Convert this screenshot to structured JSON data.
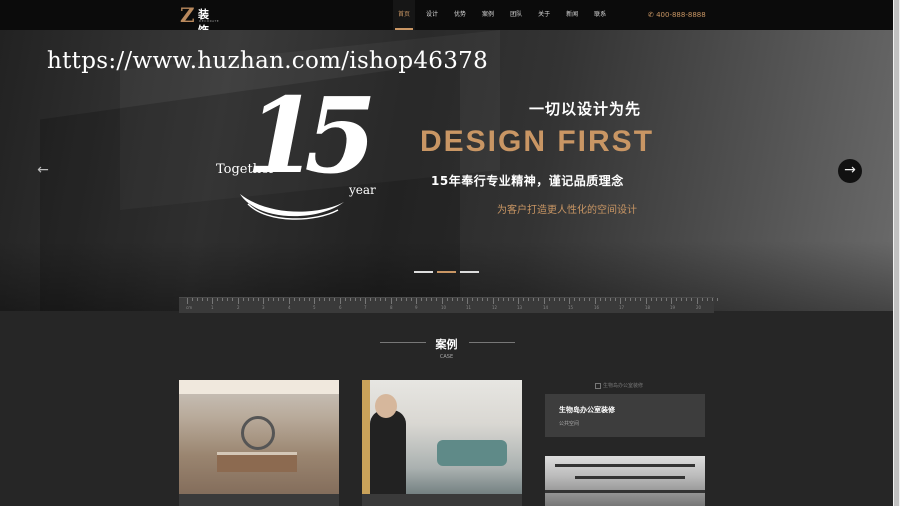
{
  "nav": {
    "logo_letter": "Z",
    "logo_text": "装饰",
    "logo_sub": "DECORATE",
    "menu": [
      "首页",
      "设计",
      "优势",
      "案例",
      "团队",
      "关于",
      "新闻",
      "联系"
    ],
    "active_index": 0,
    "phone": "✆ 400-888-8888",
    "accent_color": "#c99664"
  },
  "hero": {
    "watermark": "https://www.huzhan.com/ishop46378",
    "badge_number": "15",
    "badge_together": "Together",
    "badge_year": "year",
    "slogan_cn": "一切以设计为先",
    "slogan_en": "DESIGN FIRST",
    "tagline": "15年奉行专业精神，谨记品质理念",
    "subline": "为客户打造更人性化的空间设计",
    "prev_icon": "←",
    "next_icon": "→",
    "slide_count": 3,
    "active_slide": 1
  },
  "ruler": {
    "labels": [
      "cm",
      "1",
      "2",
      "3",
      "4",
      "5",
      "6",
      "7",
      "8",
      "9",
      "10",
      "11",
      "12",
      "13",
      "14",
      "15",
      "16",
      "17",
      "18",
      "19",
      "20"
    ]
  },
  "cases": {
    "title": "案例",
    "subtitle": "CASE",
    "items": [
      {
        "title": "生物岛办公室装修",
        "category": "公共空间",
        "broken_alt": "生物岛办公室装修"
      }
    ]
  }
}
